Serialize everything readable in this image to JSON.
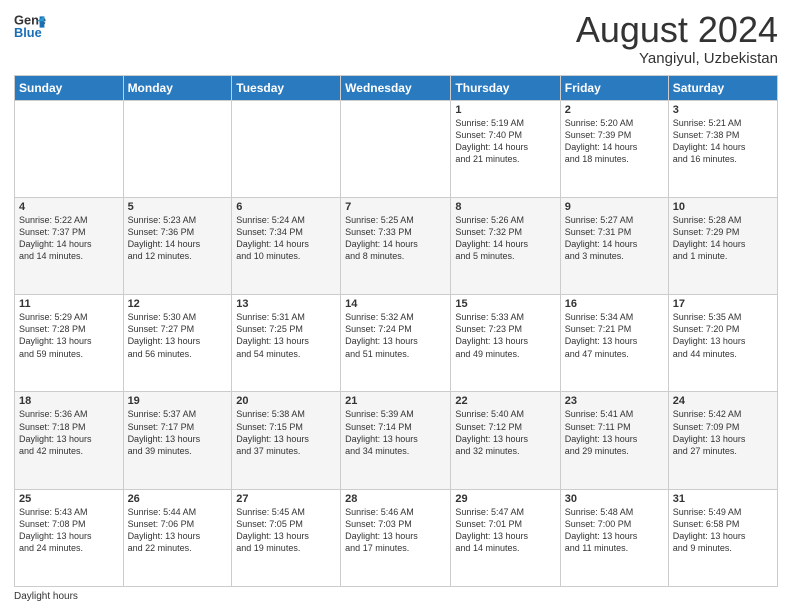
{
  "header": {
    "logo_line1": "General",
    "logo_line2": "Blue",
    "month_year": "August 2024",
    "location": "Yangiyul, Uzbekistan"
  },
  "days_of_week": [
    "Sunday",
    "Monday",
    "Tuesday",
    "Wednesday",
    "Thursday",
    "Friday",
    "Saturday"
  ],
  "weeks": [
    [
      {
        "day": "",
        "info": ""
      },
      {
        "day": "",
        "info": ""
      },
      {
        "day": "",
        "info": ""
      },
      {
        "day": "",
        "info": ""
      },
      {
        "day": "1",
        "info": "Sunrise: 5:19 AM\nSunset: 7:40 PM\nDaylight: 14 hours\nand 21 minutes."
      },
      {
        "day": "2",
        "info": "Sunrise: 5:20 AM\nSunset: 7:39 PM\nDaylight: 14 hours\nand 18 minutes."
      },
      {
        "day": "3",
        "info": "Sunrise: 5:21 AM\nSunset: 7:38 PM\nDaylight: 14 hours\nand 16 minutes."
      }
    ],
    [
      {
        "day": "4",
        "info": "Sunrise: 5:22 AM\nSunset: 7:37 PM\nDaylight: 14 hours\nand 14 minutes."
      },
      {
        "day": "5",
        "info": "Sunrise: 5:23 AM\nSunset: 7:36 PM\nDaylight: 14 hours\nand 12 minutes."
      },
      {
        "day": "6",
        "info": "Sunrise: 5:24 AM\nSunset: 7:34 PM\nDaylight: 14 hours\nand 10 minutes."
      },
      {
        "day": "7",
        "info": "Sunrise: 5:25 AM\nSunset: 7:33 PM\nDaylight: 14 hours\nand 8 minutes."
      },
      {
        "day": "8",
        "info": "Sunrise: 5:26 AM\nSunset: 7:32 PM\nDaylight: 14 hours\nand 5 minutes."
      },
      {
        "day": "9",
        "info": "Sunrise: 5:27 AM\nSunset: 7:31 PM\nDaylight: 14 hours\nand 3 minutes."
      },
      {
        "day": "10",
        "info": "Sunrise: 5:28 AM\nSunset: 7:29 PM\nDaylight: 14 hours\nand 1 minute."
      }
    ],
    [
      {
        "day": "11",
        "info": "Sunrise: 5:29 AM\nSunset: 7:28 PM\nDaylight: 13 hours\nand 59 minutes."
      },
      {
        "day": "12",
        "info": "Sunrise: 5:30 AM\nSunset: 7:27 PM\nDaylight: 13 hours\nand 56 minutes."
      },
      {
        "day": "13",
        "info": "Sunrise: 5:31 AM\nSunset: 7:25 PM\nDaylight: 13 hours\nand 54 minutes."
      },
      {
        "day": "14",
        "info": "Sunrise: 5:32 AM\nSunset: 7:24 PM\nDaylight: 13 hours\nand 51 minutes."
      },
      {
        "day": "15",
        "info": "Sunrise: 5:33 AM\nSunset: 7:23 PM\nDaylight: 13 hours\nand 49 minutes."
      },
      {
        "day": "16",
        "info": "Sunrise: 5:34 AM\nSunset: 7:21 PM\nDaylight: 13 hours\nand 47 minutes."
      },
      {
        "day": "17",
        "info": "Sunrise: 5:35 AM\nSunset: 7:20 PM\nDaylight: 13 hours\nand 44 minutes."
      }
    ],
    [
      {
        "day": "18",
        "info": "Sunrise: 5:36 AM\nSunset: 7:18 PM\nDaylight: 13 hours\nand 42 minutes."
      },
      {
        "day": "19",
        "info": "Sunrise: 5:37 AM\nSunset: 7:17 PM\nDaylight: 13 hours\nand 39 minutes."
      },
      {
        "day": "20",
        "info": "Sunrise: 5:38 AM\nSunset: 7:15 PM\nDaylight: 13 hours\nand 37 minutes."
      },
      {
        "day": "21",
        "info": "Sunrise: 5:39 AM\nSunset: 7:14 PM\nDaylight: 13 hours\nand 34 minutes."
      },
      {
        "day": "22",
        "info": "Sunrise: 5:40 AM\nSunset: 7:12 PM\nDaylight: 13 hours\nand 32 minutes."
      },
      {
        "day": "23",
        "info": "Sunrise: 5:41 AM\nSunset: 7:11 PM\nDaylight: 13 hours\nand 29 minutes."
      },
      {
        "day": "24",
        "info": "Sunrise: 5:42 AM\nSunset: 7:09 PM\nDaylight: 13 hours\nand 27 minutes."
      }
    ],
    [
      {
        "day": "25",
        "info": "Sunrise: 5:43 AM\nSunset: 7:08 PM\nDaylight: 13 hours\nand 24 minutes."
      },
      {
        "day": "26",
        "info": "Sunrise: 5:44 AM\nSunset: 7:06 PM\nDaylight: 13 hours\nand 22 minutes."
      },
      {
        "day": "27",
        "info": "Sunrise: 5:45 AM\nSunset: 7:05 PM\nDaylight: 13 hours\nand 19 minutes."
      },
      {
        "day": "28",
        "info": "Sunrise: 5:46 AM\nSunset: 7:03 PM\nDaylight: 13 hours\nand 17 minutes."
      },
      {
        "day": "29",
        "info": "Sunrise: 5:47 AM\nSunset: 7:01 PM\nDaylight: 13 hours\nand 14 minutes."
      },
      {
        "day": "30",
        "info": "Sunrise: 5:48 AM\nSunset: 7:00 PM\nDaylight: 13 hours\nand 11 minutes."
      },
      {
        "day": "31",
        "info": "Sunrise: 5:49 AM\nSunset: 6:58 PM\nDaylight: 13 hours\nand 9 minutes."
      }
    ]
  ],
  "footer": {
    "daylight_label": "Daylight hours"
  }
}
